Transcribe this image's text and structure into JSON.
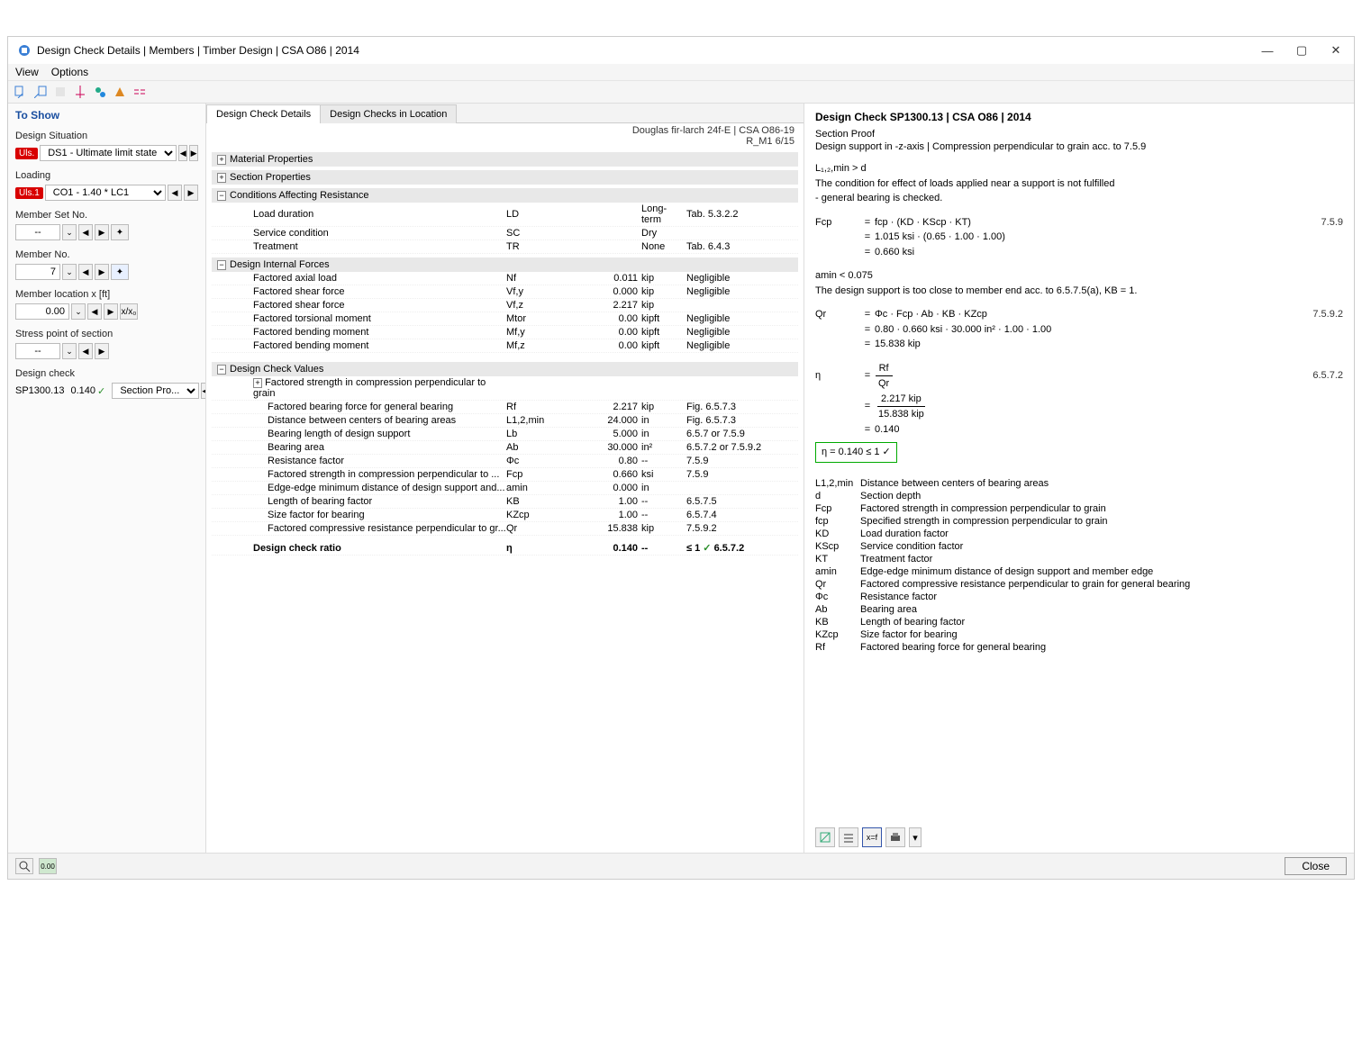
{
  "window": {
    "title": "Design Check Details | Members | Timber Design | CSA O86 | 2014",
    "min": "—",
    "max": "▢",
    "close": "✕"
  },
  "menubar": {
    "view": "View",
    "options": "Options"
  },
  "sidebar": {
    "heading": "To Show",
    "design_situation_label": "Design Situation",
    "ds_tag": "Uls.",
    "ds_value": "DS1 - Ultimate limit state",
    "loading_label": "Loading",
    "co_tag": "Uls.1",
    "co_value": "CO1 - 1.40 * LC1",
    "member_set_label": "Member Set No.",
    "member_set_value": "--",
    "member_no_label": "Member No.",
    "member_no_value": "7",
    "member_loc_label": "Member location x [ft]",
    "member_loc_value": "0.00",
    "xx0": "x/x₀",
    "stress_pt_label": "Stress point of section",
    "stress_pt_value": "--",
    "design_check_label": "Design check",
    "dc_id": "SP1300.13",
    "dc_ratio": "0.140",
    "dc_check": "✓",
    "dc_type": "Section Pro..."
  },
  "tabs": {
    "t1": "Design Check Details",
    "t2": "Design Checks in Location"
  },
  "header": {
    "material": "Douglas fir-larch 24f-E | CSA O86-19",
    "member": "R_M1 6/15"
  },
  "groups": {
    "g1": "Material Properties",
    "g2": "Section Properties",
    "g3": "Conditions Affecting Resistance",
    "g4": "Design Internal Forces",
    "g5": "Design Check Values",
    "g5sub": "Factored strength in compression perpendicular to grain"
  },
  "conditions": [
    {
      "name": "Load duration",
      "sym": "LD",
      "val": "",
      "unit": "Long-term",
      "ref": "Tab. 5.3.2.2"
    },
    {
      "name": "Service condition",
      "sym": "SC",
      "val": "",
      "unit": "Dry",
      "ref": ""
    },
    {
      "name": "Treatment",
      "sym": "TR",
      "val": "",
      "unit": "None",
      "ref": "Tab. 6.4.3"
    }
  ],
  "forces": [
    {
      "name": "Factored axial load",
      "sym": "Nf",
      "val": "0.011",
      "unit": "kip",
      "ref": "Negligible"
    },
    {
      "name": "Factored shear force",
      "sym": "Vf,y",
      "val": "0.000",
      "unit": "kip",
      "ref": "Negligible"
    },
    {
      "name": "Factored shear force",
      "sym": "Vf,z",
      "val": "2.217",
      "unit": "kip",
      "ref": ""
    },
    {
      "name": "Factored torsional moment",
      "sym": "Mtor",
      "val": "0.00",
      "unit": "kipft",
      "ref": "Negligible"
    },
    {
      "name": "Factored bending moment",
      "sym": "Mf,y",
      "val": "0.00",
      "unit": "kipft",
      "ref": "Negligible"
    },
    {
      "name": "Factored bending moment",
      "sym": "Mf,z",
      "val": "0.00",
      "unit": "kipft",
      "ref": "Negligible"
    }
  ],
  "checks": [
    {
      "name": "Factored bearing force for general bearing",
      "sym": "Rf",
      "val": "2.217",
      "unit": "kip",
      "ref": "Fig. 6.5.7.3"
    },
    {
      "name": "Distance between centers of bearing areas",
      "sym": "L1,2,min",
      "val": "24.000",
      "unit": "in",
      "ref": "Fig. 6.5.7.3"
    },
    {
      "name": "Bearing length of design support",
      "sym": "Lb",
      "val": "5.000",
      "unit": "in",
      "ref": "6.5.7 or 7.5.9"
    },
    {
      "name": "Bearing area",
      "sym": "Ab",
      "val": "30.000",
      "unit": "in²",
      "ref": "6.5.7.2 or 7.5.9.2"
    },
    {
      "name": "Resistance factor",
      "sym": "Φc",
      "val": "0.80",
      "unit": "--",
      "ref": "7.5.9"
    },
    {
      "name": "Factored strength in compression perpendicular to ...",
      "sym": "Fcp",
      "val": "0.660",
      "unit": "ksi",
      "ref": "7.5.9"
    },
    {
      "name": "Edge-edge minimum distance of design support and...",
      "sym": "amin",
      "val": "0.000",
      "unit": "in",
      "ref": ""
    },
    {
      "name": "Length of bearing factor",
      "sym": "KB",
      "val": "1.00",
      "unit": "--",
      "ref": "6.5.7.5"
    },
    {
      "name": "Size factor for bearing",
      "sym": "KZcp",
      "val": "1.00",
      "unit": "--",
      "ref": "6.5.7.4"
    },
    {
      "name": "Factored compressive resistance perpendicular to gr...",
      "sym": "Qr",
      "val": "15.838",
      "unit": "kip",
      "ref": "7.5.9.2"
    }
  ],
  "ratio": {
    "name": "Design check ratio",
    "sym": "η",
    "val": "0.140",
    "unit": "--",
    "cmp": "≤ 1",
    "chk": "✓",
    "ref": "6.5.7.2"
  },
  "right": {
    "title": "Design Check SP1300.13 | CSA O86 | 2014",
    "sub1": "Section Proof",
    "sub2": "Design support in -z-axis | Compression perpendicular to grain acc. to 7.5.9",
    "cond1": "L₁,₂,min  >  d",
    "cond1_note1": "The condition for effect of loads applied near a support is not fulfilled",
    "cond1_note2": "- general bearing is checked.",
    "fcp_sym": "Fcp",
    "fcp_expr1": "fcp  ·  (KD · KScp · KT)",
    "fcp_expr2": "1.015 ksi  ·  (0.65 · 1.00 · 1.00)",
    "fcp_expr3": "0.660 ksi",
    "fcp_ref": "7.5.9",
    "amin_cond": "amin  <  0.075",
    "amin_note": "The design support is too close to member end acc. to 6.5.7.5(a), KB = 1.",
    "qr_sym": "Qr",
    "qr_expr1": "Φc  ·  Fcp  ·  Ab  ·  KB  ·  KZcp",
    "qr_expr2": "0.80  ·  0.660 ksi  ·  30.000 in²  ·  1.00  ·  1.00",
    "qr_expr3": "15.838 kip",
    "qr_ref": "7.5.9.2",
    "eta_sym": "η",
    "eta_num": "Rf",
    "eta_den": "Qr",
    "eta_num2": "2.217 kip",
    "eta_den2": "15.838 kip",
    "eta_val": "0.140",
    "eta_ref": "6.5.7.2",
    "eta_box": "η   =   0.140  ≤ 1 ✓"
  },
  "legend": [
    {
      "s": "L1,2,min",
      "d": "Distance between centers of bearing areas"
    },
    {
      "s": "d",
      "d": "Section depth"
    },
    {
      "s": "Fcp",
      "d": "Factored strength in compression perpendicular to grain"
    },
    {
      "s": "fcp",
      "d": "Specified strength in compression perpendicular to grain"
    },
    {
      "s": "KD",
      "d": "Load duration factor"
    },
    {
      "s": "KScp",
      "d": "Service condition factor"
    },
    {
      "s": "KT",
      "d": "Treatment factor"
    },
    {
      "s": "amin",
      "d": "Edge-edge minimum distance of design support and member edge"
    },
    {
      "s": "Qr",
      "d": "Factored compressive resistance perpendicular to grain for general bearing"
    },
    {
      "s": "Φc",
      "d": "Resistance factor"
    },
    {
      "s": "Ab",
      "d": "Bearing area"
    },
    {
      "s": "KB",
      "d": "Length of bearing factor"
    },
    {
      "s": "KZcp",
      "d": "Size factor for bearing"
    },
    {
      "s": "Rf",
      "d": "Factored bearing force for general bearing"
    }
  ],
  "footer": {
    "close": "Close"
  }
}
